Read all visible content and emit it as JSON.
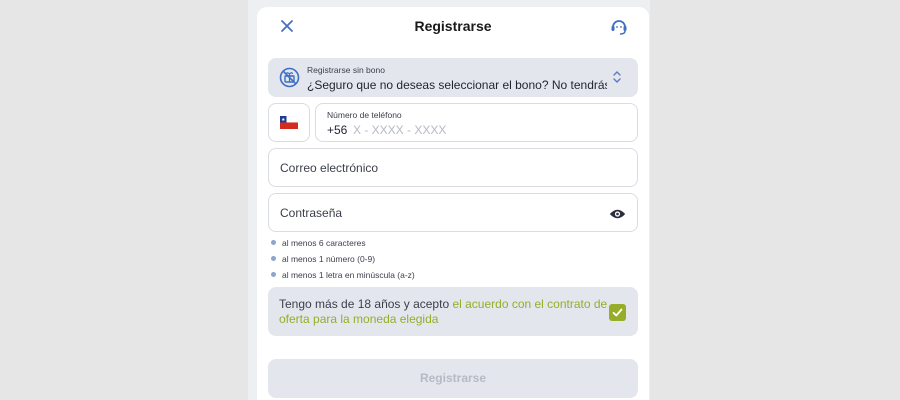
{
  "header": {
    "title": "Registrarse",
    "close_icon": "close-icon",
    "support_icon": "support-headset-icon"
  },
  "bonus": {
    "label": "Registrarse sin bono",
    "value": "¿Seguro que no deseas seleccionar el bono? No tendrás otra ...",
    "icon": "no-gift-icon",
    "chevron_icon": "chevron-up-down-icon"
  },
  "phone": {
    "country_icon": "chile-flag-icon",
    "label": "Número de teléfono",
    "prefix": "+56",
    "placeholder": "X - XXXX - XXXX"
  },
  "email": {
    "placeholder": "Correo electrónico"
  },
  "password": {
    "placeholder": "Contraseña",
    "eye_icon": "eye-icon"
  },
  "password_rules": [
    "al menos 6 caracteres",
    "al menos 1 número (0-9)",
    "al menos 1 letra en minúscula (a-z)"
  ],
  "terms": {
    "text": "Tengo más de 18 años y acepto ",
    "link": "el acuerdo con el contrato de oferta para la moneda elegida",
    "checked": true
  },
  "submit": {
    "label": "Registrarse"
  },
  "colors": {
    "accent": "#94ae2a",
    "close": "#4a6fbf",
    "field_bg": "#e4e6ee",
    "disabled_text": "#b6bac4"
  }
}
